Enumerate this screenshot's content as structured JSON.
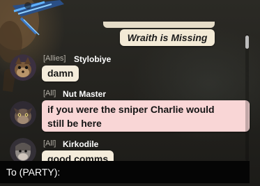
{
  "chat": {
    "system_message": "Wraith is Missing",
    "messages": [
      {
        "channel": "[Allies]",
        "sender": "Stylobiye",
        "text": "damn"
      },
      {
        "channel": "[All]",
        "sender": "Nut Master",
        "lines": [
          "if you were the sniper Charlie would",
          "still be here"
        ]
      },
      {
        "channel": "[All]",
        "sender": "Kirkodile",
        "text": "good comms"
      }
    ]
  },
  "input": {
    "prefix": "To (PARTY):",
    "value": ""
  },
  "colors": {
    "system_bubble": "#f3ead6",
    "allies_bubble": "#f4ecdb",
    "all_bubble_highlight": "#f9d6d6",
    "input_bar": "#050505"
  }
}
